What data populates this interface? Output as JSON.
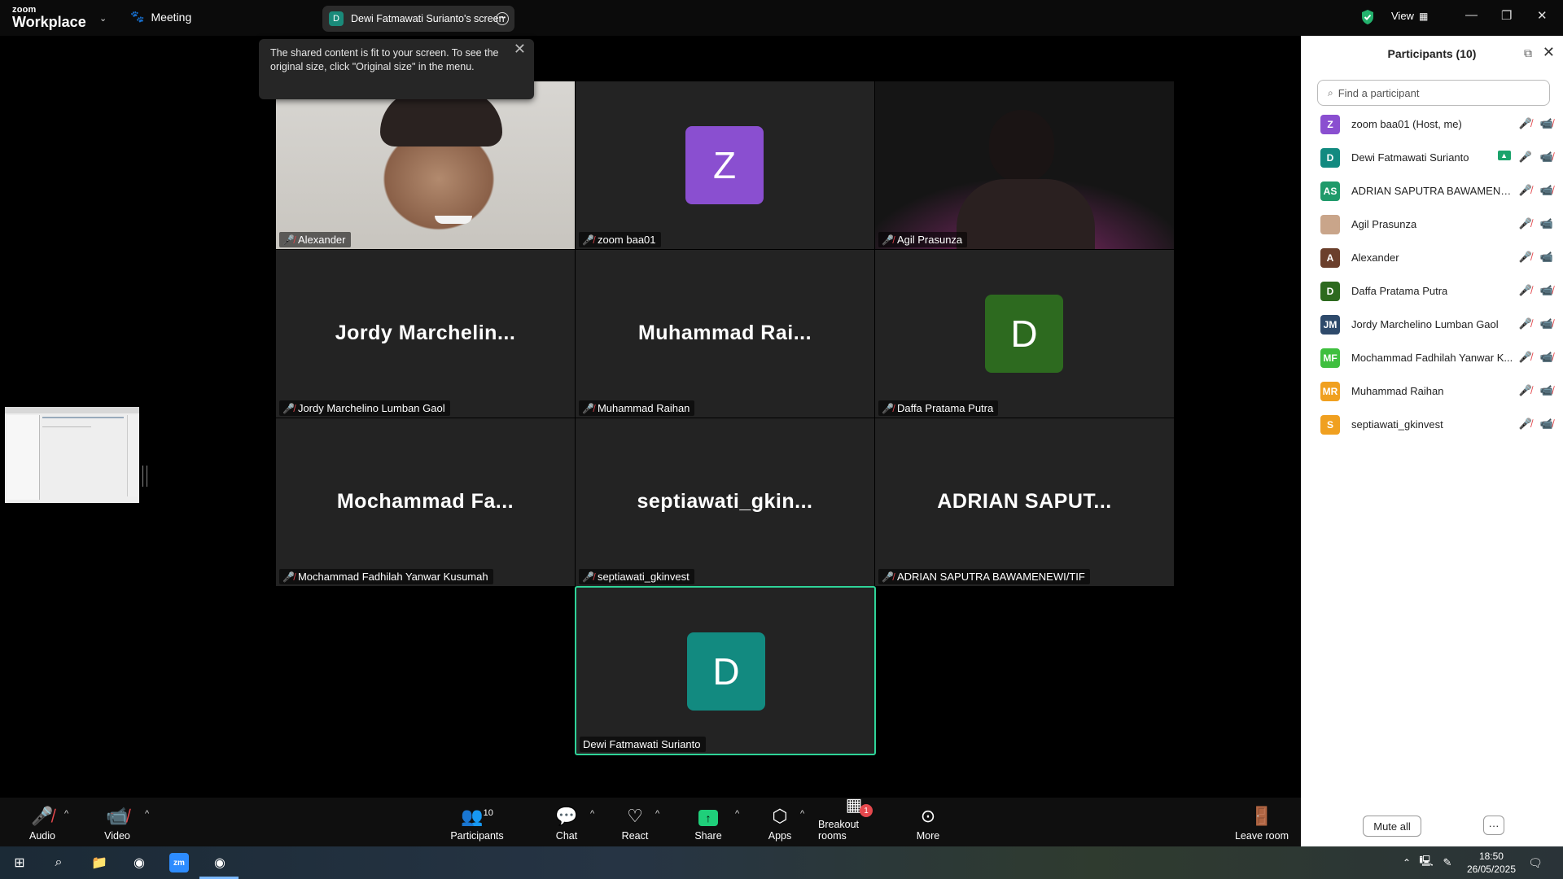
{
  "app": {
    "logo_line1": "zoom",
    "logo_line2": "Workplace",
    "meeting_label": "Meeting"
  },
  "share_pill": {
    "initial": "D",
    "label": "Dewi Fatmawati Surianto's screen"
  },
  "view_label": "View",
  "tooltip": {
    "text": "The shared content is fit to your screen. To see the original size, click \"Original size\" in the menu."
  },
  "tiles": [
    {
      "name": "Alexander",
      "kind": "video"
    },
    {
      "name": "zoom baa01",
      "kind": "avatar",
      "initial": "Z",
      "color": "#8a4fd0"
    },
    {
      "name": "Agil Prasunza",
      "kind": "video-dark"
    },
    {
      "name": "Jordy Marchelino Lumban Gaol",
      "kind": "text",
      "big": "Jordy  Marchelin..."
    },
    {
      "name": "Muhammad Raihan",
      "kind": "text",
      "big": "Muhammad  Rai..."
    },
    {
      "name": "Daffa Pratama Putra",
      "kind": "avatar",
      "initial": "D",
      "color": "#2d6a1f"
    },
    {
      "name": "Mochammad Fadhilah Yanwar Kusumah",
      "kind": "text",
      "big": "Mochammad  Fa..."
    },
    {
      "name": "septiawati_gkinvest",
      "kind": "text",
      "big": "septiawati_gkin..."
    },
    {
      "name": "ADRIAN SAPUTRA BAWAMENEWI/TIF",
      "kind": "text",
      "big": "ADRIAN  SAPUT..."
    },
    {
      "name": "Dewi Fatmawati Surianto",
      "kind": "avatar",
      "initial": "D",
      "color": "#128a80"
    }
  ],
  "panel": {
    "title": "Participants (10)",
    "search_placeholder": "Find a participant",
    "participants": [
      {
        "initials": "Z",
        "name": "zoom baa01 (Host, me)",
        "color": "#8a4fd0",
        "video": "off"
      },
      {
        "initials": "D",
        "name": "Dewi Fatmawati Surianto",
        "color": "#128a80",
        "video": "off",
        "sharing": true
      },
      {
        "initials": "AS",
        "name": "ADRIAN SAPUTRA BAWAMENEW...",
        "color": "#1f9a6a",
        "video": "off"
      },
      {
        "initials": "",
        "name": "Agil Prasunza",
        "color": "#c9a58a",
        "video": "on"
      },
      {
        "initials": "A",
        "name": "Alexander",
        "color": "#6b3f2c",
        "video": "on"
      },
      {
        "initials": "D",
        "name": "Daffa Pratama Putra",
        "color": "#2d6a1f",
        "video": "off"
      },
      {
        "initials": "JM",
        "name": "Jordy Marchelino Lumban Gaol",
        "color": "#2e4a6b",
        "video": "off"
      },
      {
        "initials": "MF",
        "name": "Mochammad Fadhilah Yanwar K...",
        "color": "#3fbf3f",
        "video": "off"
      },
      {
        "initials": "MR",
        "name": "Muhammad Raihan",
        "color": "#f0a020",
        "video": "off"
      },
      {
        "initials": "S",
        "name": "septiawati_gkinvest",
        "color": "#f0a020",
        "video": "off"
      }
    ],
    "mute_all": "Mute all",
    "more": "···"
  },
  "toolbar": {
    "audio": "Audio",
    "video": "Video",
    "participants": "Participants",
    "participants_count": "10",
    "chat": "Chat",
    "react": "React",
    "share": "Share",
    "apps": "Apps",
    "breakout": "Breakout rooms",
    "breakout_badge": "1",
    "more": "More",
    "leave": "Leave room"
  },
  "taskbar": {
    "time": "18:50",
    "date": "26/05/2025"
  }
}
